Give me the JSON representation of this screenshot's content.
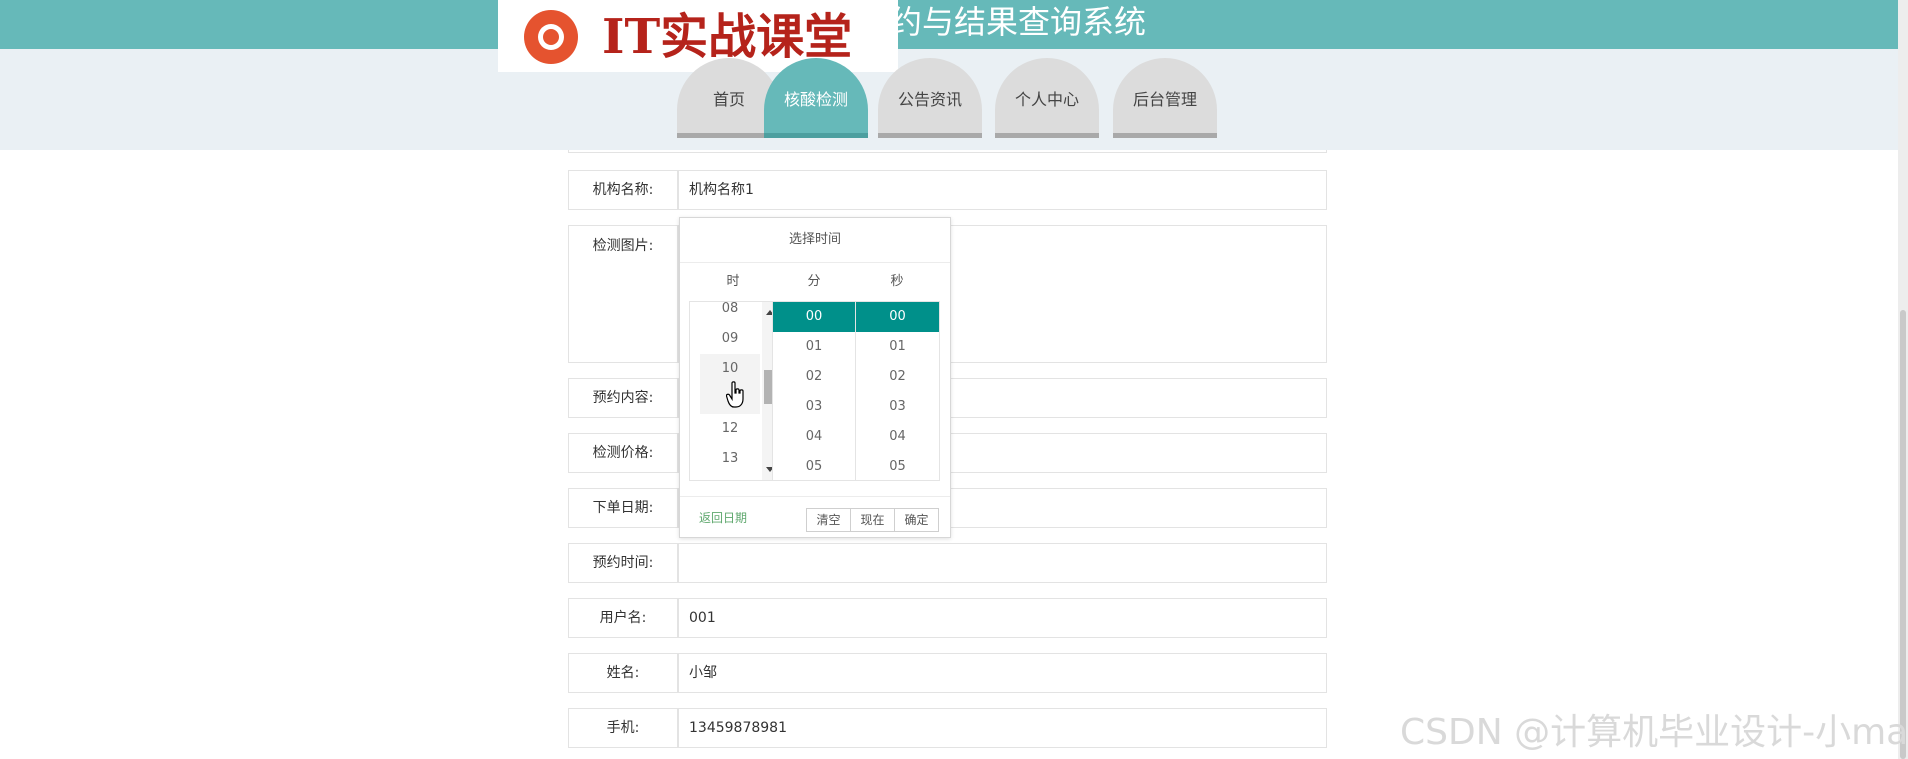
{
  "header": {
    "title": "约与结果查询系统",
    "logo_text": "IT实战课堂",
    "logo_icon": "chrome-style-circle-icon",
    "accent_color": "#66b9b9"
  },
  "nav": {
    "tabs": [
      {
        "label": "首页",
        "active": false
      },
      {
        "label": "核酸检测",
        "active": true
      },
      {
        "label": "公告资讯",
        "active": false
      },
      {
        "label": "个人中心",
        "active": false
      },
      {
        "label": "后台管理",
        "active": false
      }
    ]
  },
  "form": {
    "rows": [
      {
        "label": "机构名称:",
        "value": "机构名称1"
      },
      {
        "label": "检测图片:",
        "value": ""
      },
      {
        "label": "预约内容:",
        "value": ""
      },
      {
        "label": "检测价格:",
        "value": ""
      },
      {
        "label": "下单日期:",
        "value": ""
      },
      {
        "label": "预约时间:",
        "value": ""
      },
      {
        "label": "用户名:",
        "value": "001"
      },
      {
        "label": "姓名:",
        "value": "小邹"
      },
      {
        "label": "手机:",
        "value": "13459878981"
      }
    ]
  },
  "time_picker": {
    "title": "选择时间",
    "columns": [
      "时",
      "分",
      "秒"
    ],
    "hours": [
      "08",
      "09",
      "10",
      "",
      "12",
      "13"
    ],
    "minutes": [
      "00",
      "01",
      "02",
      "03",
      "04",
      "05"
    ],
    "seconds": [
      "00",
      "01",
      "02",
      "03",
      "04",
      "05"
    ],
    "selected_minute": "00",
    "selected_second": "00",
    "back_label": "返回日期",
    "buttons": {
      "clear": "清空",
      "now": "现在",
      "ok": "确定"
    },
    "selected_color": "#00908a"
  },
  "watermark": "CSDN @计算机毕业设计-小ma"
}
